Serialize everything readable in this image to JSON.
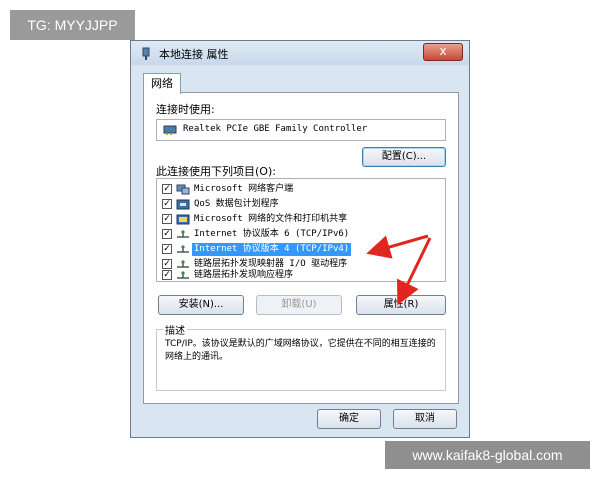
{
  "overlay": {
    "tag": "TG: MYYJJPP",
    "watermark": "www.kaifak8-global.com"
  },
  "window": {
    "title": "本地连接 属性",
    "close_symbol": "x",
    "tab": "网络"
  },
  "connection": {
    "label": "连接时使用:",
    "adapter": "Realtek PCIe GBE Family Controller",
    "configure_button": "配置(C)..."
  },
  "items_label": "此连接使用下列项目(O):",
  "items": [
    {
      "label": "Microsoft 网络客户端",
      "checked": "✓",
      "icon": "network-client-icon"
    },
    {
      "label": "QoS 数据包计划程序",
      "checked": "✓",
      "icon": "qos-icon"
    },
    {
      "label": "Microsoft 网络的文件和打印机共享",
      "checked": "✓",
      "icon": "file-sharing-icon"
    },
    {
      "label": "Internet 协议版本 6 (TCP/IPv6)",
      "checked": "✓",
      "icon": "protocol-icon"
    },
    {
      "label": "Internet 协议版本 4 (TCP/IPv4)",
      "checked": "✓",
      "icon": "protocol-icon"
    },
    {
      "label": "链路层拓扑发现映射器 I/O 驱动程序",
      "checked": "✓",
      "icon": "protocol-icon"
    },
    {
      "label": "链路层拓扑发现响应程序",
      "checked": "✓",
      "icon": "protocol-icon"
    }
  ],
  "buttons": {
    "install": "安装(N)...",
    "uninstall": "卸载(U)",
    "properties": "属性(R)"
  },
  "description": {
    "title": "描述",
    "text": "TCP/IP。该协议是默认的广域网络协议，它提供在不同的相互连接的网络上的通讯。"
  },
  "footer": {
    "ok": "确定",
    "cancel": "取消"
  },
  "colors": {
    "selection": "#3399ff",
    "arrow": "#e0261f"
  }
}
